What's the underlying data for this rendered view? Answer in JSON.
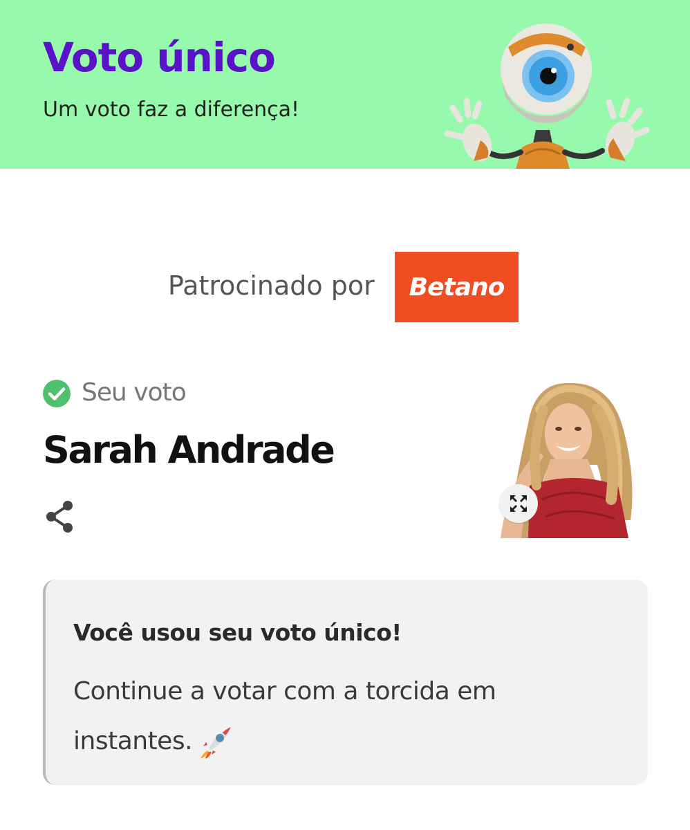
{
  "header": {
    "title": "Voto único",
    "subtitle": "Um voto faz a diferença!",
    "mascot_icon": "big-brother-eye-mascot",
    "background_color": "#97f9ac",
    "title_color": "#5a12c8"
  },
  "sponsor": {
    "label": "Patrocinado por",
    "logo_text": "Betano",
    "logo_color": "#f04d23"
  },
  "vote": {
    "status_label": "Seu voto",
    "status_icon": "check-circle-icon",
    "status_color": "#4fc06e",
    "candidate_name": "Sarah Andrade",
    "share_icon": "share-icon",
    "expand_icon": "expand-icon"
  },
  "message": {
    "title": "Você usou seu voto único!",
    "body": "Continue a votar com a torcida em instantes.",
    "emoji_icon": "rocket-icon"
  }
}
